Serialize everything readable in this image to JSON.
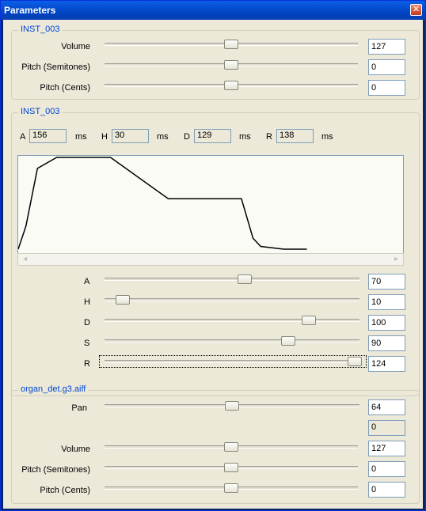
{
  "window": {
    "title": "Parameters",
    "close_glyph": "✕"
  },
  "group1": {
    "title": "INST_003",
    "rows": [
      {
        "label": "Volume",
        "value": "127",
        "level": 0.5
      },
      {
        "label": "Pitch (Semitones)",
        "value": "0",
        "level": 0.5
      },
      {
        "label": "Pitch (Cents)",
        "value": "0",
        "level": 0.5
      }
    ]
  },
  "group2": {
    "title": "INST_003",
    "ahdr": [
      {
        "letter": "A",
        "value": "156",
        "unit": "ms"
      },
      {
        "letter": "H",
        "value": "30",
        "unit": "ms"
      },
      {
        "letter": "D",
        "value": "129",
        "unit": "ms"
      },
      {
        "letter": "R",
        "value": "138",
        "unit": "ms"
      }
    ],
    "envelope": [
      [
        0,
        1
      ],
      [
        0.02,
        0.75
      ],
      [
        0.05,
        0.12
      ],
      [
        0.1,
        0
      ],
      [
        0.24,
        0
      ],
      [
        0.39,
        0.45
      ],
      [
        0.44,
        0.45
      ],
      [
        0.58,
        0.45
      ],
      [
        0.61,
        0.88
      ],
      [
        0.63,
        0.97
      ],
      [
        0.69,
        1
      ],
      [
        0.75,
        1
      ]
    ],
    "sliders": [
      {
        "label": "A",
        "value": "70",
        "level": 0.55
      },
      {
        "label": "H",
        "value": "10",
        "level": 0.07
      },
      {
        "label": "D",
        "value": "100",
        "level": 0.8
      },
      {
        "label": "S",
        "value": "90",
        "level": 0.72
      },
      {
        "label": "R",
        "value": "124",
        "level": 0.98
      }
    ]
  },
  "group3": {
    "title": "organ_det.g3.aiff",
    "pan": {
      "label": "Pan",
      "value": "64",
      "level": 0.5,
      "readout": "0"
    },
    "rows": [
      {
        "label": "Volume",
        "value": "127",
        "level": 0.5
      },
      {
        "label": "Pitch (Semitones)",
        "value": "0",
        "level": 0.5
      },
      {
        "label": "Pitch (Cents)",
        "value": "0",
        "level": 0.5
      }
    ]
  },
  "icons": {
    "scroll_left": "◂",
    "scroll_right": "▸"
  }
}
